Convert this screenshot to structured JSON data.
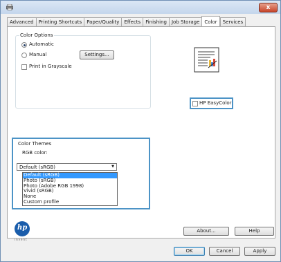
{
  "window": {
    "close_label": "x"
  },
  "tabs": [
    {
      "label": "Advanced"
    },
    {
      "label": "Printing Shortcuts"
    },
    {
      "label": "Paper/Quality"
    },
    {
      "label": "Effects"
    },
    {
      "label": "Finishing"
    },
    {
      "label": "Job Storage"
    },
    {
      "label": "Color",
      "active": true
    },
    {
      "label": "Services"
    }
  ],
  "color_options": {
    "title": "Color Options",
    "automatic_label": "Automatic",
    "manual_label": "Manual",
    "settings_button": "Settings...",
    "grayscale_label": "Print in Grayscale",
    "selected": "Automatic",
    "grayscale_checked": false
  },
  "easycolor": {
    "label": "HP EasyColor",
    "checked": false
  },
  "color_themes": {
    "title": "Color Themes",
    "subtitle": "RGB color:",
    "selected_value": "Default (sRGB)",
    "options": [
      "Default (sRGB)",
      "Photo (sRGB)",
      "Photo (Adobe RGB 1998)",
      "Vivid (sRGB)",
      "None",
      "Custom profile"
    ]
  },
  "bottom": {
    "about_button": "About...",
    "help_button": "Help",
    "ok_button": "OK",
    "cancel_button": "Cancel",
    "apply_button": "Apply",
    "logo_text": "invent"
  },
  "colors": {
    "highlight": "#4c93c6",
    "selection": "#3399ff",
    "hp_blue": "#1a5dab"
  }
}
